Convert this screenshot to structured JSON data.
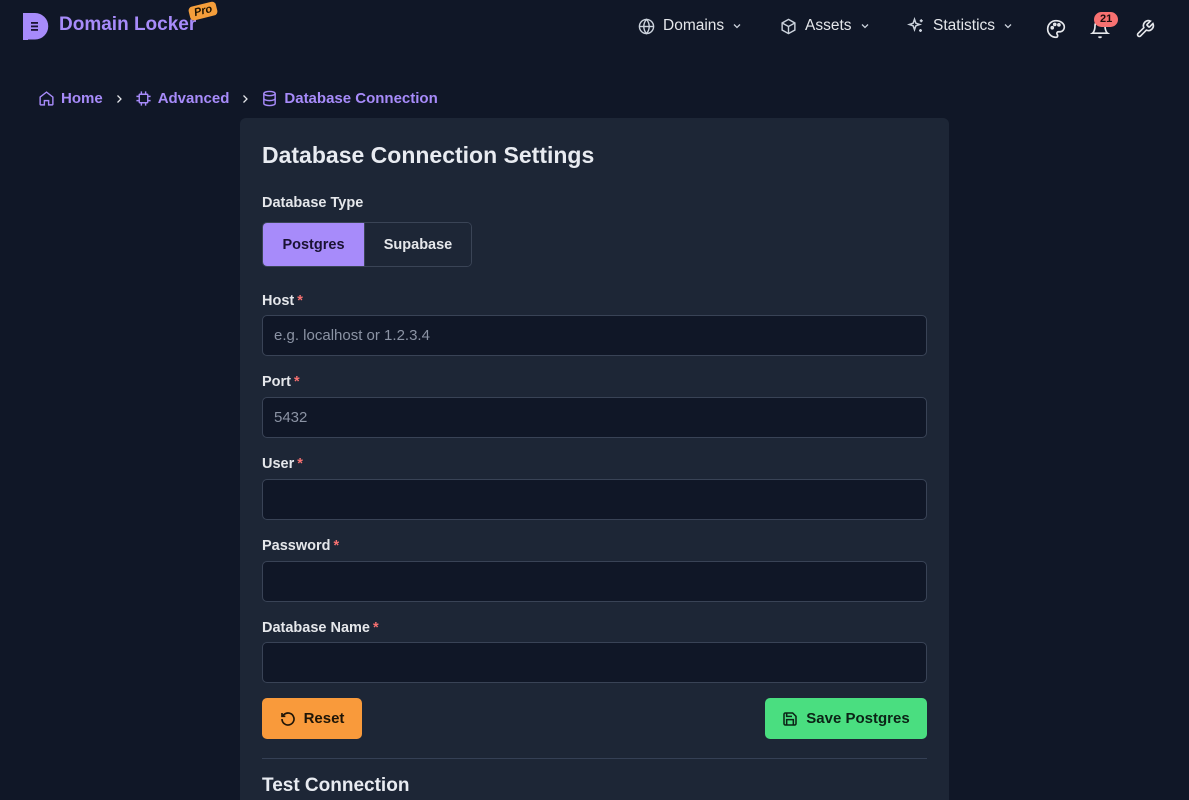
{
  "brand": {
    "name": "Domain Locker",
    "badge": "Pro"
  },
  "nav": {
    "items": [
      {
        "label": "Domains",
        "icon": "globe-icon"
      },
      {
        "label": "Assets",
        "icon": "cube-icon"
      },
      {
        "label": "Statistics",
        "icon": "sparkles-icon"
      }
    ],
    "notifications_count": "21"
  },
  "breadcrumb": [
    {
      "label": "Home",
      "icon": "home-icon"
    },
    {
      "label": "Advanced",
      "icon": "chip-icon"
    },
    {
      "label": "Database Connection",
      "icon": "database-icon"
    }
  ],
  "form": {
    "title": "Database Connection Settings",
    "db_type_label": "Database Type",
    "db_types": [
      "Postgres",
      "Supabase"
    ],
    "selected_db_type": "Postgres",
    "required_marker": "*",
    "fields": {
      "host": {
        "label": "Host",
        "placeholder": "e.g. localhost or 1.2.3.4",
        "value": ""
      },
      "port": {
        "label": "Port",
        "placeholder": "5432",
        "value": ""
      },
      "user": {
        "label": "User",
        "placeholder": "",
        "value": ""
      },
      "password": {
        "label": "Password",
        "placeholder": "",
        "value": ""
      },
      "database_name": {
        "label": "Database Name",
        "placeholder": "",
        "value": ""
      }
    },
    "reset_label": "Reset",
    "save_label": "Save Postgres",
    "test_section_title": "Test Connection"
  },
  "colors": {
    "background": "#101727",
    "card": "#1d2636",
    "accent": "#a78bfa",
    "reset": "#f99a3b",
    "save": "#4ade80",
    "required": "#f87171"
  }
}
